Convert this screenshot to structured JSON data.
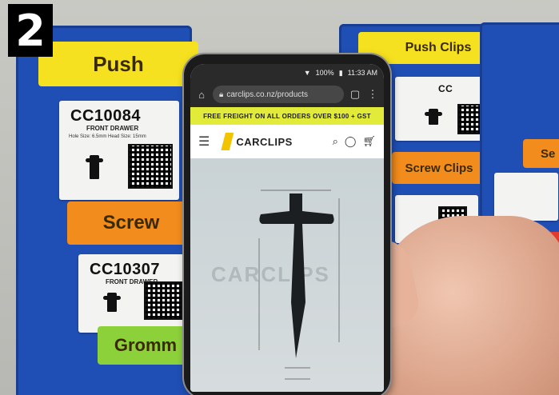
{
  "step_badge": "2",
  "rack": {
    "left_labels": [
      "Push",
      "Screw",
      "Gromm"
    ],
    "right_labels": [
      "Push Clips",
      "Screw Clips"
    ],
    "right_partial_labels": [
      "Se"
    ],
    "cards": [
      {
        "code": "CC10084",
        "subtitle": "FRONT DRAWER",
        "fine": "Hole Size: 6.5mm    Head Size: 15mm"
      },
      {
        "code": "CC10307",
        "subtitle": "FRONT DRAWER",
        "fine": ""
      },
      {
        "code": "CC",
        "subtitle": "",
        "fine": ""
      }
    ]
  },
  "phone": {
    "status": {
      "battery": "100%",
      "time": "11:33 AM"
    },
    "url": "carclips.co.nz/products",
    "banner": "FREE FREIGHT ON ALL ORDERS OVER $100 + GST",
    "logo": "CARCLIPS",
    "watermark": "CARCLIPS"
  },
  "colors": {
    "rack_blue": "#1f4fb5",
    "label_yellow": "#f5e11f",
    "label_orange": "#f28c1c",
    "label_green": "#8dd13a",
    "banner_yellow": "#e2ea3a"
  }
}
